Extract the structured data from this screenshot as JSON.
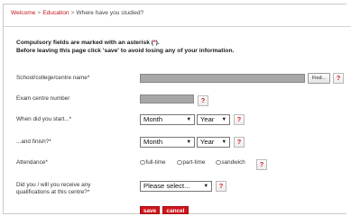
{
  "breadcrumb": {
    "items": [
      "Welcome",
      "Education"
    ],
    "current": "Where have you studied?",
    "separator": ">"
  },
  "notice": {
    "line1_prefix": "Compulsory fields are marked with an asterisk (",
    "asterisk": "*",
    "line1_suffix": ").",
    "line2": "Before leaving this page click 'save' to avoid losing any of your information."
  },
  "form": {
    "school": {
      "label": "School/college/centre name*",
      "value": "",
      "find_button": "Find...",
      "help": "?"
    },
    "exam_centre": {
      "label": "Exam centre number",
      "value": "",
      "help": "?"
    },
    "start": {
      "label": "When did you start...*",
      "month": "Month",
      "year": "Year",
      "help": "?"
    },
    "finish": {
      "label": "...and finish?*",
      "month": "Month",
      "year": "Year",
      "help": "?"
    },
    "attendance": {
      "label": "Attendance*",
      "options": [
        "full-time",
        "part-time",
        "sandwich"
      ],
      "help": "?"
    },
    "qualifications": {
      "label_line1": "Did you / will you receive any",
      "label_line2": "qualifications at this centre?*",
      "selected": "Please select...",
      "help": "?"
    }
  },
  "actions": {
    "save": "save",
    "cancel": "cancel"
  },
  "colors": {
    "accent_red": "#d2141b",
    "link_red": "#c0141d",
    "field_grey": "#a7a7a7"
  }
}
